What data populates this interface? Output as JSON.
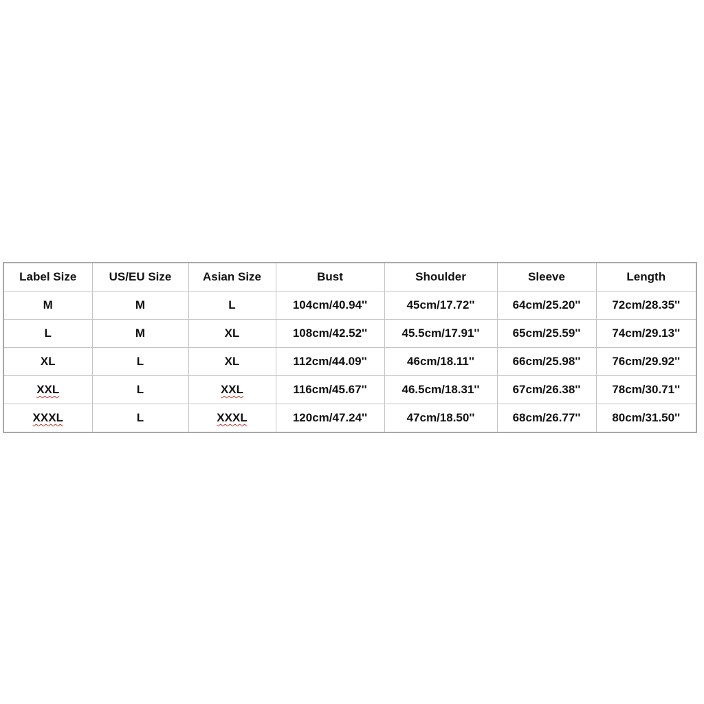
{
  "table": {
    "headers": [
      "Label Size",
      "US/EU Size",
      "Asian Size",
      "Bust",
      "Shoulder",
      "Sleeve",
      "Length"
    ],
    "rows": [
      [
        "M",
        "M",
        "L",
        "104cm/40.94''",
        "45cm/17.72''",
        "64cm/25.20''",
        "72cm/28.35''"
      ],
      [
        "L",
        "M",
        "XL",
        "108cm/42.52''",
        "45.5cm/17.91''",
        "65cm/25.59''",
        "74cm/29.13''"
      ],
      [
        "XL",
        "L",
        "XL",
        "112cm/44.09''",
        "46cm/18.11''",
        "66cm/25.98''",
        "76cm/29.92''"
      ],
      [
        "XXL",
        "L",
        "XXL",
        "116cm/45.67''",
        "46.5cm/18.31''",
        "67cm/26.38''",
        "78cm/30.71''"
      ],
      [
        "XXXL",
        "L",
        "XXXL",
        "120cm/47.24''",
        "47cm/18.50''",
        "68cm/26.77''",
        "80cm/31.50''"
      ]
    ],
    "spellcheck_marked_cells": [
      [
        3,
        0
      ],
      [
        3,
        2
      ],
      [
        4,
        0
      ],
      [
        4,
        2
      ]
    ]
  },
  "colors": {
    "text": "#111111",
    "border": "#c4c4c4",
    "outer_border": "#a8a8a8",
    "spellcheck_underline": "#c0392b",
    "background": "#ffffff"
  }
}
